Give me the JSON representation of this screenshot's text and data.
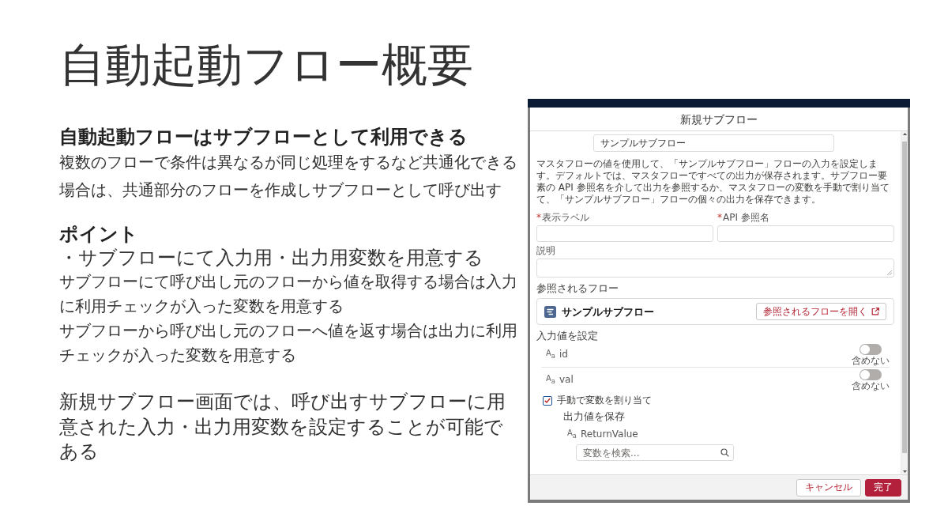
{
  "slide": {
    "title": "自動起動フロー概要"
  },
  "notes": {
    "heading": "自動起動フローはサブフローとして利用できる",
    "intro": "複数のフローで条件は異なるが同じ処理をするなど共通化できる場合は、共通部分のフローを作成しサブフローとして呼び出す",
    "point_heading": "ポイント",
    "point": "・サブフローにて入力用・出力用変数を用意する",
    "point_details": [
      "サブフローにて呼び出し元のフローから値を取得する場合は入力に利用チェックが入った変数を用意する",
      "サブフローから呼び出し元のフローへ値を返す場合は出力に利用チェックが入った変数を用意する"
    ],
    "summary": "新規サブフロー画面では、呼び出すサブフローに用意された入力・出力用変数を設定することが可能である"
  },
  "dialog": {
    "title": "新規サブフロー",
    "flow_field": {
      "value": "サンプルサブフロー"
    },
    "help_text": "マスタフローの値を使用して、「サンプルサブフロー」フローの入力を設定します。デフォルトでは、マスタフローですべての出力が保存されます。サブフロー要素の API 参照名を介して出力を参照するか、マスタフローの変数を手動で割り当てて、「サンプルサブフロー」フローの個々の出力を保存できます。",
    "fields": [
      {
        "label": "表示ラベル",
        "required_mark": "*"
      },
      {
        "label": "API 参照名",
        "required_mark": "*"
      }
    ],
    "description_field": {
      "label": "説明"
    },
    "referenced_flow": {
      "heading": "参照されるフロー",
      "name": "サンプルサブフロー",
      "open_button": "参照されるフローを開く"
    },
    "inputs": {
      "heading": "入力値を設定",
      "variables": [
        {
          "type_mark": "A$_{a}$",
          "name": "id",
          "on": false,
          "toggle_label": "含めない"
        },
        {
          "type_mark": "A$_{a}$",
          "name": "val",
          "on": false,
          "toggle_label": "含めない"
        }
      ]
    },
    "manual_assign": {
      "label": "手動で変数を割り当て",
      "checked": true
    },
    "outputs": {
      "heading": "出力値を保存",
      "variables": [
        {
          "type_mark": "A$_{a}$",
          "name": "ReturnValue",
          "placeholder": "変数を検索..."
        }
      ]
    },
    "buttons": [
      {
        "label": "キャンセル",
        "kind": "neutral"
      },
      {
        "label": "完了",
        "kind": "brand"
      }
    ]
  }
}
